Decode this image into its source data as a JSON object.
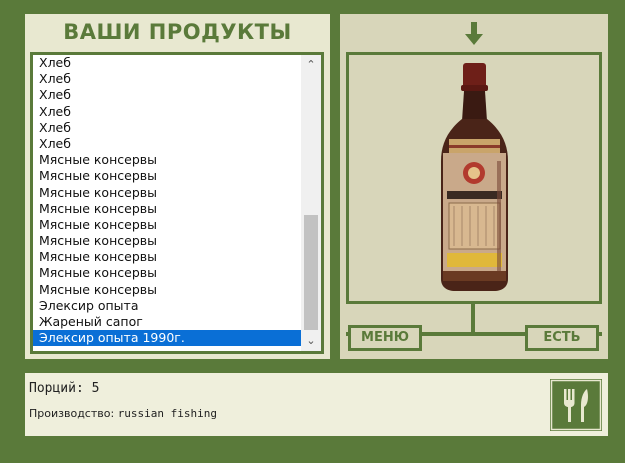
{
  "products_panel": {
    "title": "ВАШИ ПРОДУКТЫ",
    "items": [
      "Хлеб",
      "Хлеб",
      "Хлеб",
      "Хлеб",
      "Хлеб",
      "Хлеб",
      "Мясные консервы",
      "Мясные консервы",
      "Мясные консервы",
      "Мясные консервы",
      "Мясные консервы",
      "Мясные консервы",
      "Мясные консервы",
      "Мясные консервы",
      "Мясные консервы",
      "Элексир опыта",
      "Жареный сапог",
      "Элексир опыта 1990г."
    ],
    "selected_index": 17
  },
  "preview": {
    "image_icon": "wine-bottle",
    "arrow_icon": "arrow-down-icon",
    "menu_label": "МЕНЮ",
    "eat_label": "ЕСТЬ"
  },
  "info": {
    "portions": "Порций: 5",
    "production_label": "Производство:",
    "production_value": "russian fishing",
    "eat_icon": "cutlery-icon"
  },
  "colors": {
    "background": "#5a7a3a",
    "panel": "#e8e8d0",
    "selected": "#0a6fd6"
  }
}
